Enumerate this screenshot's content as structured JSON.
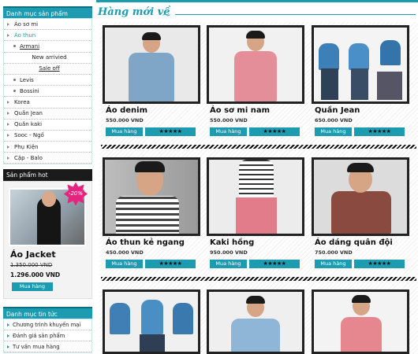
{
  "sidebar": {
    "category_title": "Danh mục sản phẩm",
    "categories": [
      {
        "label": "Áo sơ mi",
        "level": 0
      },
      {
        "label": "Áo thun",
        "level": 0
      },
      {
        "label": "Armani",
        "level": 1
      },
      {
        "label": "New arrivied",
        "level": 2
      },
      {
        "label": "Sale off",
        "level": 2
      },
      {
        "label": "Levis",
        "level": 1
      },
      {
        "label": "Bossini",
        "level": 1
      },
      {
        "label": "Korea",
        "level": 0
      },
      {
        "label": "Quần Jean",
        "level": 0
      },
      {
        "label": "Quần kaki",
        "level": 0
      },
      {
        "label": "Sooc - Ngố",
        "level": 0
      },
      {
        "label": "Phụ Kiện",
        "level": 0
      },
      {
        "label": "Cặp - Balo",
        "level": 0
      }
    ],
    "hot_title": "Sản phẩm hot",
    "hot": {
      "badge": "-20%",
      "name": "Áo Jacket",
      "old_price": "1.350.000 VND",
      "price": "1.296.000 VND",
      "buy_label": "Mua hàng"
    },
    "news_title": "Danh mục tin tức",
    "news": [
      "Chương trình khuyến mại",
      "Đánh giá sản phẩm",
      "Tư vấn mua hàng"
    ]
  },
  "main": {
    "title": "Hàng mới về",
    "buy_label": "Mua hàng",
    "rating_label": "★★★★★",
    "products": [
      {
        "name": "Áo denim",
        "price": "550.000 VND"
      },
      {
        "name": "Áo sơ mi nam",
        "price": "550.000 VND"
      },
      {
        "name": "Quần Jean",
        "price": "650.000 VND"
      },
      {
        "name": "Áo thun kẻ ngang",
        "price": "450.000 VND"
      },
      {
        "name": "Kaki hồng",
        "price": "950.000 VND"
      },
      {
        "name": "Áo dáng quân đội",
        "price": "750.000 VND"
      }
    ]
  },
  "colors": {
    "accent": "#1c9bb1",
    "badge": "#e8227f"
  }
}
